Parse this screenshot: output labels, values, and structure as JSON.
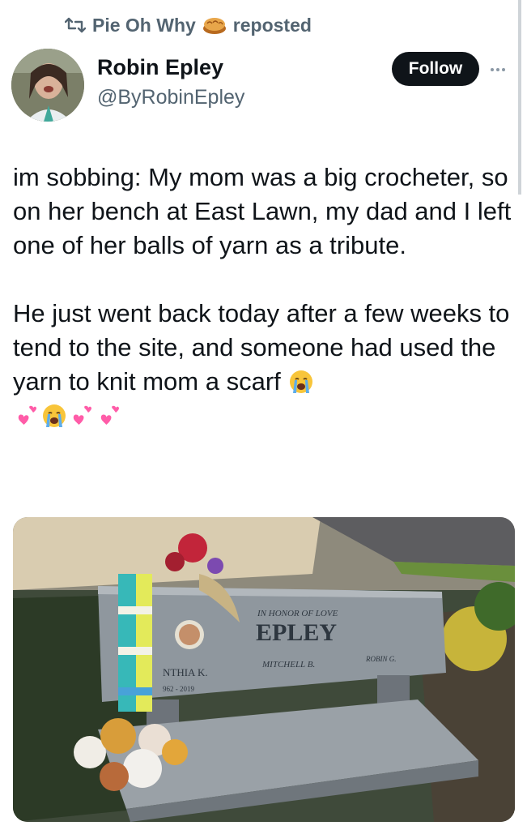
{
  "repost": {
    "name": "Pie Oh Why",
    "action": "reposted",
    "pie_icon": "pie-emoji"
  },
  "author": {
    "name": "Robin Epley",
    "handle": "@ByRobinEpley",
    "follow_label": "Follow"
  },
  "tweet": {
    "paragraph1": "im sobbing: My mom was a big crocheter, so on her bench at East Lawn, my dad and I left one of her balls of yarn as a tribute.",
    "paragraph2": "He just went back today after a few weeks to tend to the site, and someone had used the yarn to knit mom a scarf",
    "emojis": [
      "loudly-crying-face",
      "two-hearts",
      "loudly-crying-face",
      "two-hearts",
      "two-hearts"
    ]
  },
  "photo": {
    "subject": "memorial bench with knitted scarf",
    "bench": {
      "line1": "IN HONOR OF LOVE",
      "surname": "EPLEY",
      "name_left": "NTHIA K.",
      "dates_left": "962 - 2019",
      "name_center": "MITCHELL B.",
      "name_right": "ROBIN G."
    }
  },
  "colors": {
    "text": "#0f1419",
    "secondary": "#536471",
    "follow_bg": "#0f1419"
  }
}
